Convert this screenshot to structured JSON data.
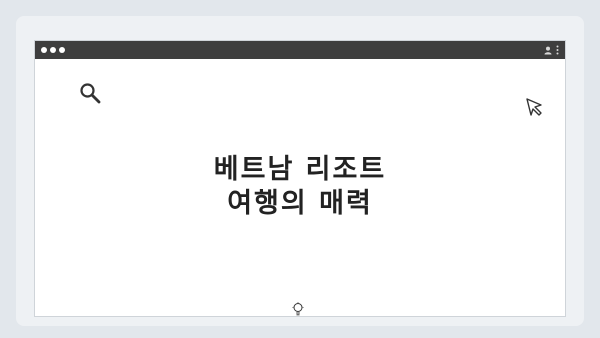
{
  "window": {
    "pagination_dots": 4
  },
  "browser": {
    "titlebar": {
      "traffic_lights": [
        "close",
        "minimize",
        "maximize"
      ],
      "icons": [
        "user-icon",
        "kebab-menu-icon"
      ]
    }
  },
  "content": {
    "headline_line1": "베트남 리조트",
    "headline_line2": "여행의 매력",
    "icons": [
      "search-icon",
      "cursor-icon",
      "lightbulb-icon"
    ],
    "colors": {
      "background": "#e2e7ec",
      "titlebar": "#3e3e3e",
      "text": "#222222"
    }
  }
}
